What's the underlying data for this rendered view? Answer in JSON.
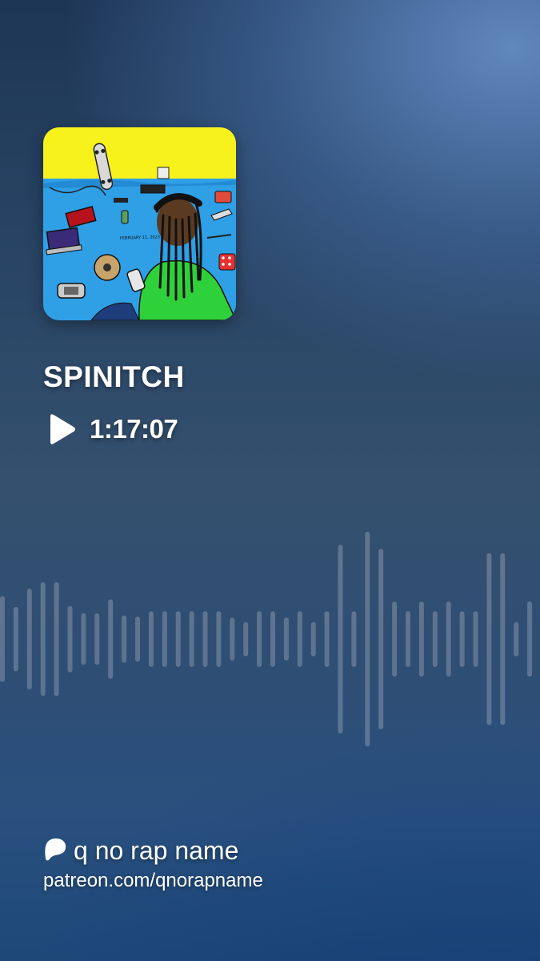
{
  "episode": {
    "title": "SPINITCH",
    "duration": "1:17:07",
    "cover_caption": "FEBRUARY 11, 2023"
  },
  "creator": {
    "name": "q no rap name",
    "url": "patreon.com/qnorapname"
  },
  "icons": {
    "play": "play-icon",
    "brand": "patreon-logo-icon"
  },
  "colors": {
    "accent_text": "#ffffff",
    "cover_sky": "#f7f21b",
    "cover_floor": "#2f9fe6",
    "cover_shirt": "#2fd13a",
    "waveform": "#ffffff"
  },
  "waveform": {
    "levels": [
      0.4,
      0.3,
      0.47,
      0.53,
      0.53,
      0.31,
      0.24,
      0.24,
      0.37,
      0.22,
      0.21,
      0.26,
      0.26,
      0.26,
      0.26,
      0.26,
      0.26,
      0.2,
      0.16,
      0.26,
      0.26,
      0.2,
      0.26,
      0.16,
      0.26,
      0.88,
      0.26,
      1.0,
      0.84,
      0.35,
      0.26,
      0.35,
      0.26,
      0.35,
      0.26,
      0.26,
      0.8,
      0.8,
      0.16,
      0.35,
      0.62
    ]
  }
}
